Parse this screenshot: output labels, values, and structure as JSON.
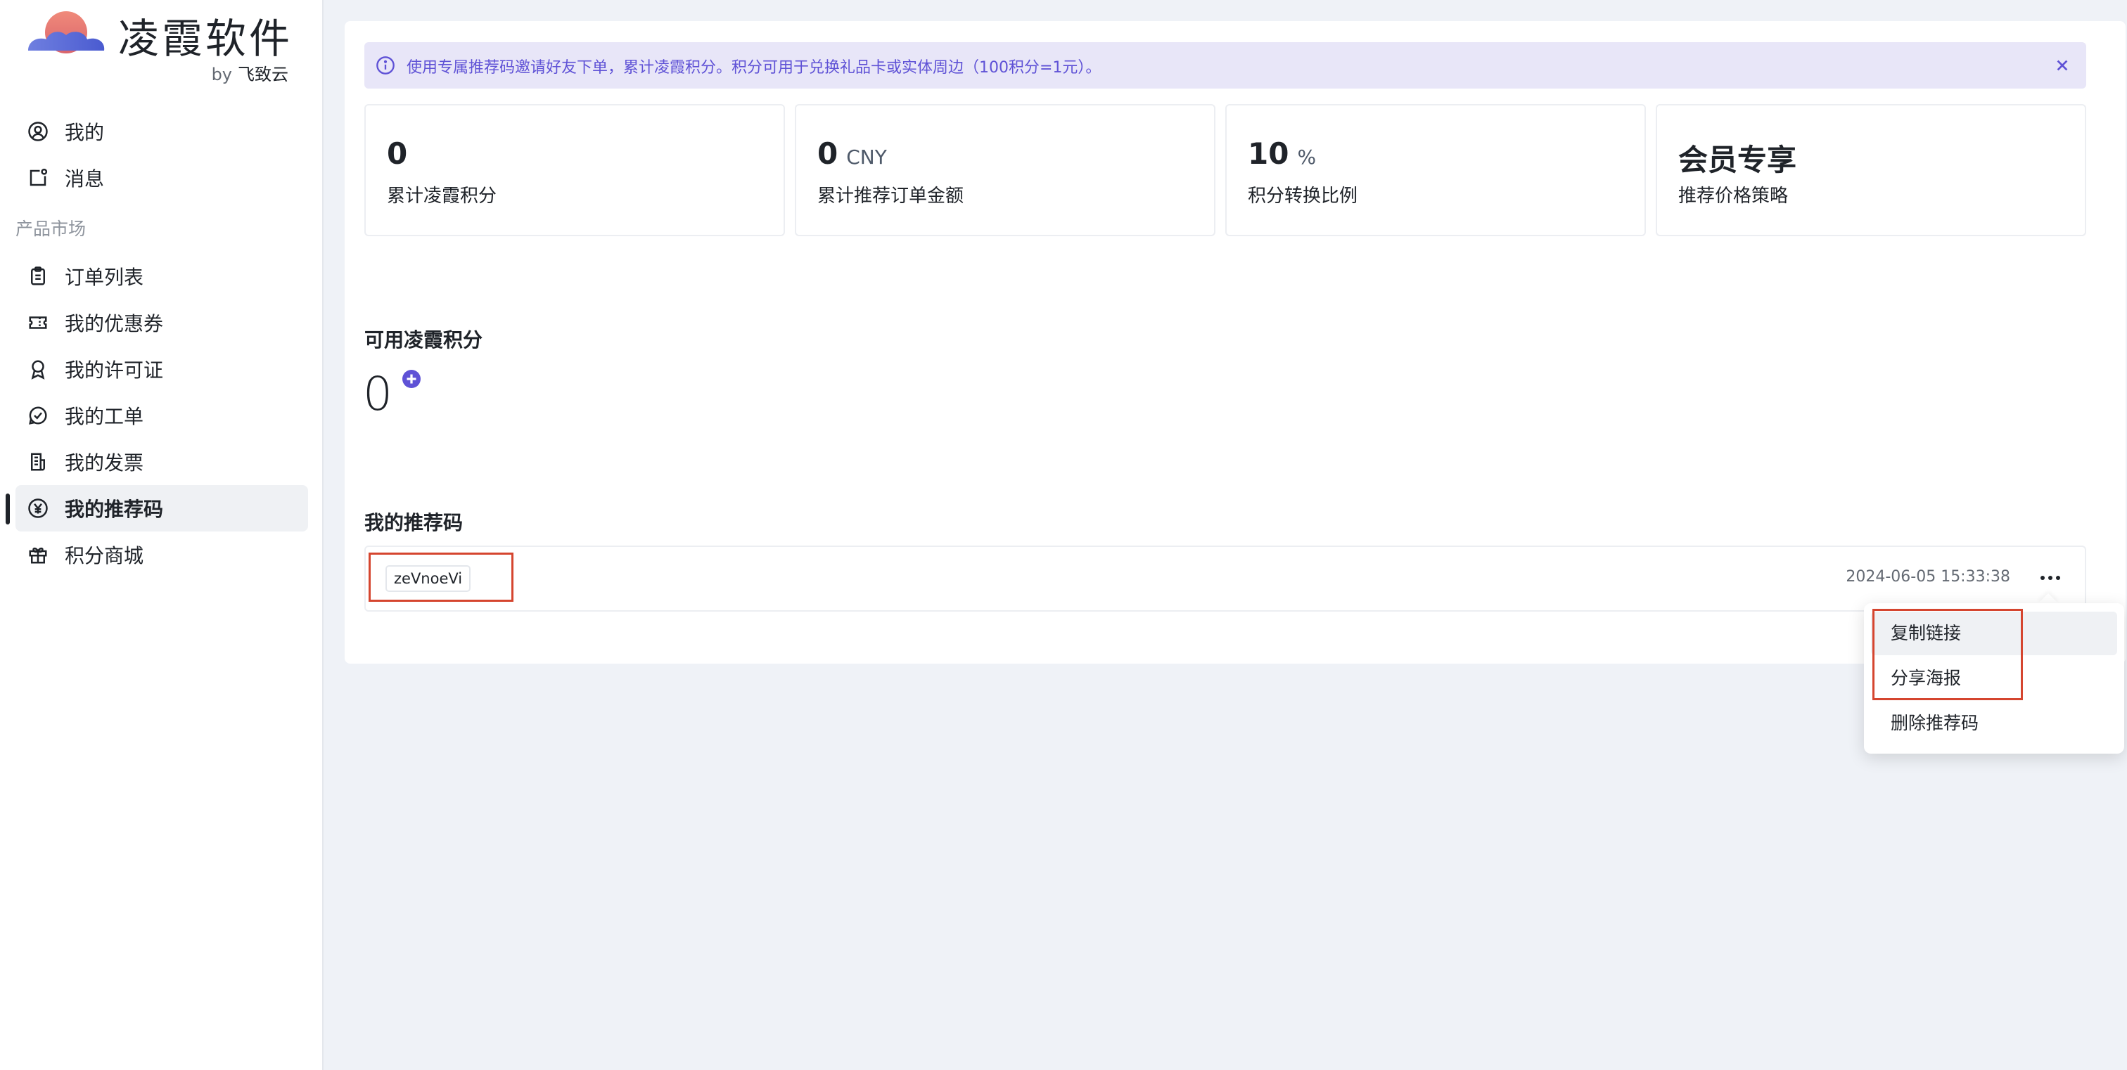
{
  "app": {
    "title": "凌霞软件",
    "by_prefix": "by",
    "by_name": "飞致云"
  },
  "sidebar": {
    "top_items": [
      {
        "label": "我的",
        "icon": "user-circle-icon"
      },
      {
        "label": "消息",
        "icon": "message-icon"
      }
    ],
    "section_title": "产品市场",
    "items": [
      {
        "label": "订单列表",
        "icon": "clipboard-icon"
      },
      {
        "label": "我的优惠券",
        "icon": "ticket-icon"
      },
      {
        "label": "我的许可证",
        "icon": "award-icon"
      },
      {
        "label": "我的工单",
        "icon": "chat-check-icon"
      },
      {
        "label": "我的发票",
        "icon": "invoice-icon"
      },
      {
        "label": "我的推荐码",
        "icon": "yen-circle-icon",
        "active": true
      },
      {
        "label": "积分商城",
        "icon": "gift-icon"
      }
    ]
  },
  "alert": {
    "text": "使用专属推荐码邀请好友下单，累计凌霞积分。积分可用于兑换礼品卡或实体周边（100积分=1元）。",
    "icon": "info-icon",
    "close_icon": "close-icon"
  },
  "stats": [
    {
      "value": "0",
      "unit": "",
      "label": "累计凌霞积分"
    },
    {
      "value": "0",
      "unit": "CNY",
      "label": "累计推荐订单金额"
    },
    {
      "value": "10",
      "unit": "%",
      "label": "积分转换比例"
    },
    {
      "value": "会员专享",
      "unit": "",
      "label": "推荐价格策略"
    }
  ],
  "available_points": {
    "title": "可用凌霞积分",
    "value": "0",
    "badge_icon": "plus-circle-icon"
  },
  "referral": {
    "title": "我的推荐码",
    "code": "zeVnoeVi",
    "created_at": "2024-06-05 15:33:38",
    "more_icon": "more-horizontal-icon"
  },
  "dropdown": {
    "items": [
      "复制链接",
      "分享海报",
      "删除推荐码"
    ]
  },
  "colors": {
    "accent": "#5f52d6",
    "alert_bg": "#e8e6f8",
    "highlight_box": "#d5452f",
    "page_bg": "#eff2f7"
  }
}
